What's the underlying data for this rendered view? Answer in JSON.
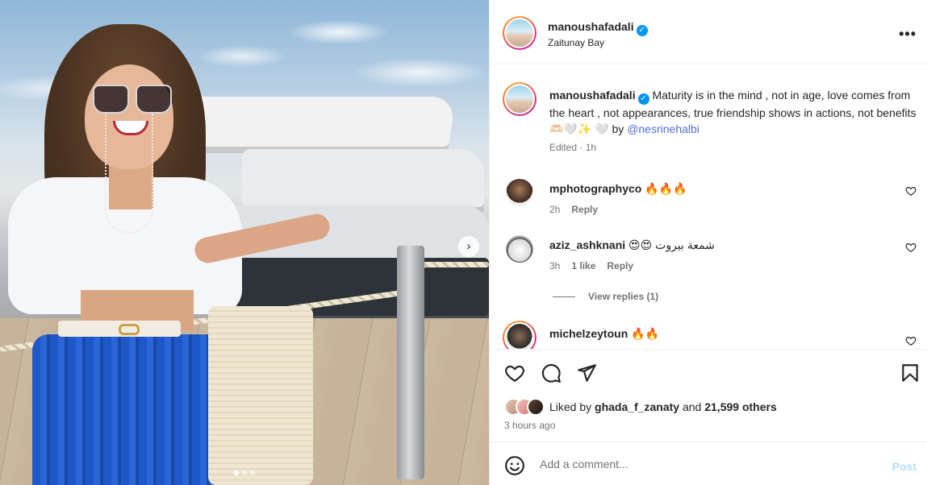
{
  "post": {
    "username": "manoushafadali",
    "verified_mark": "✓",
    "location": "Zaitunay Bay",
    "more_label": "•••"
  },
  "caption": {
    "username": "manoushafadali",
    "text": "Maturity is in the mind , not in age, love comes from the heart , not appearances, true friendship shows in actions, not benefits🫶🏻🤍✨️ 🤍 by ",
    "mention": "@nesrinehalbi",
    "meta": "Edited · 1h"
  },
  "comments": [
    {
      "username": "mphotographyco",
      "text": "🔥🔥🔥",
      "time": "2h",
      "likes": "",
      "reply_label": "Reply"
    },
    {
      "username": "aziz_ashknani",
      "text": "😍😍 شمعة بيروت",
      "time": "3h",
      "likes": "1 like",
      "reply_label": "Reply"
    },
    {
      "username": "michelzeytoun",
      "text": "🔥🔥",
      "time": "",
      "likes": "",
      "reply_label": ""
    }
  ],
  "view_replies": "View replies (1)",
  "likes": {
    "prefix": "Liked by ",
    "user": "ghada_f_zanaty",
    "middle": " and ",
    "count": "21,599 others"
  },
  "time_ago": "3 hours ago",
  "add_comment": {
    "placeholder": "Add a comment...",
    "post_label": "Post"
  },
  "carousel": {
    "next_glyph": "›",
    "slides": 3,
    "active_slide": 1
  },
  "colors": {
    "accent": "#0095f6",
    "mention": "#4f6fd8",
    "post_disabled": "#b2dffc",
    "muted": "#737373"
  },
  "icons": [
    "heart-icon",
    "comment-icon",
    "share-icon",
    "bookmark-icon",
    "emoji-icon",
    "more-icon",
    "next-icon"
  ]
}
